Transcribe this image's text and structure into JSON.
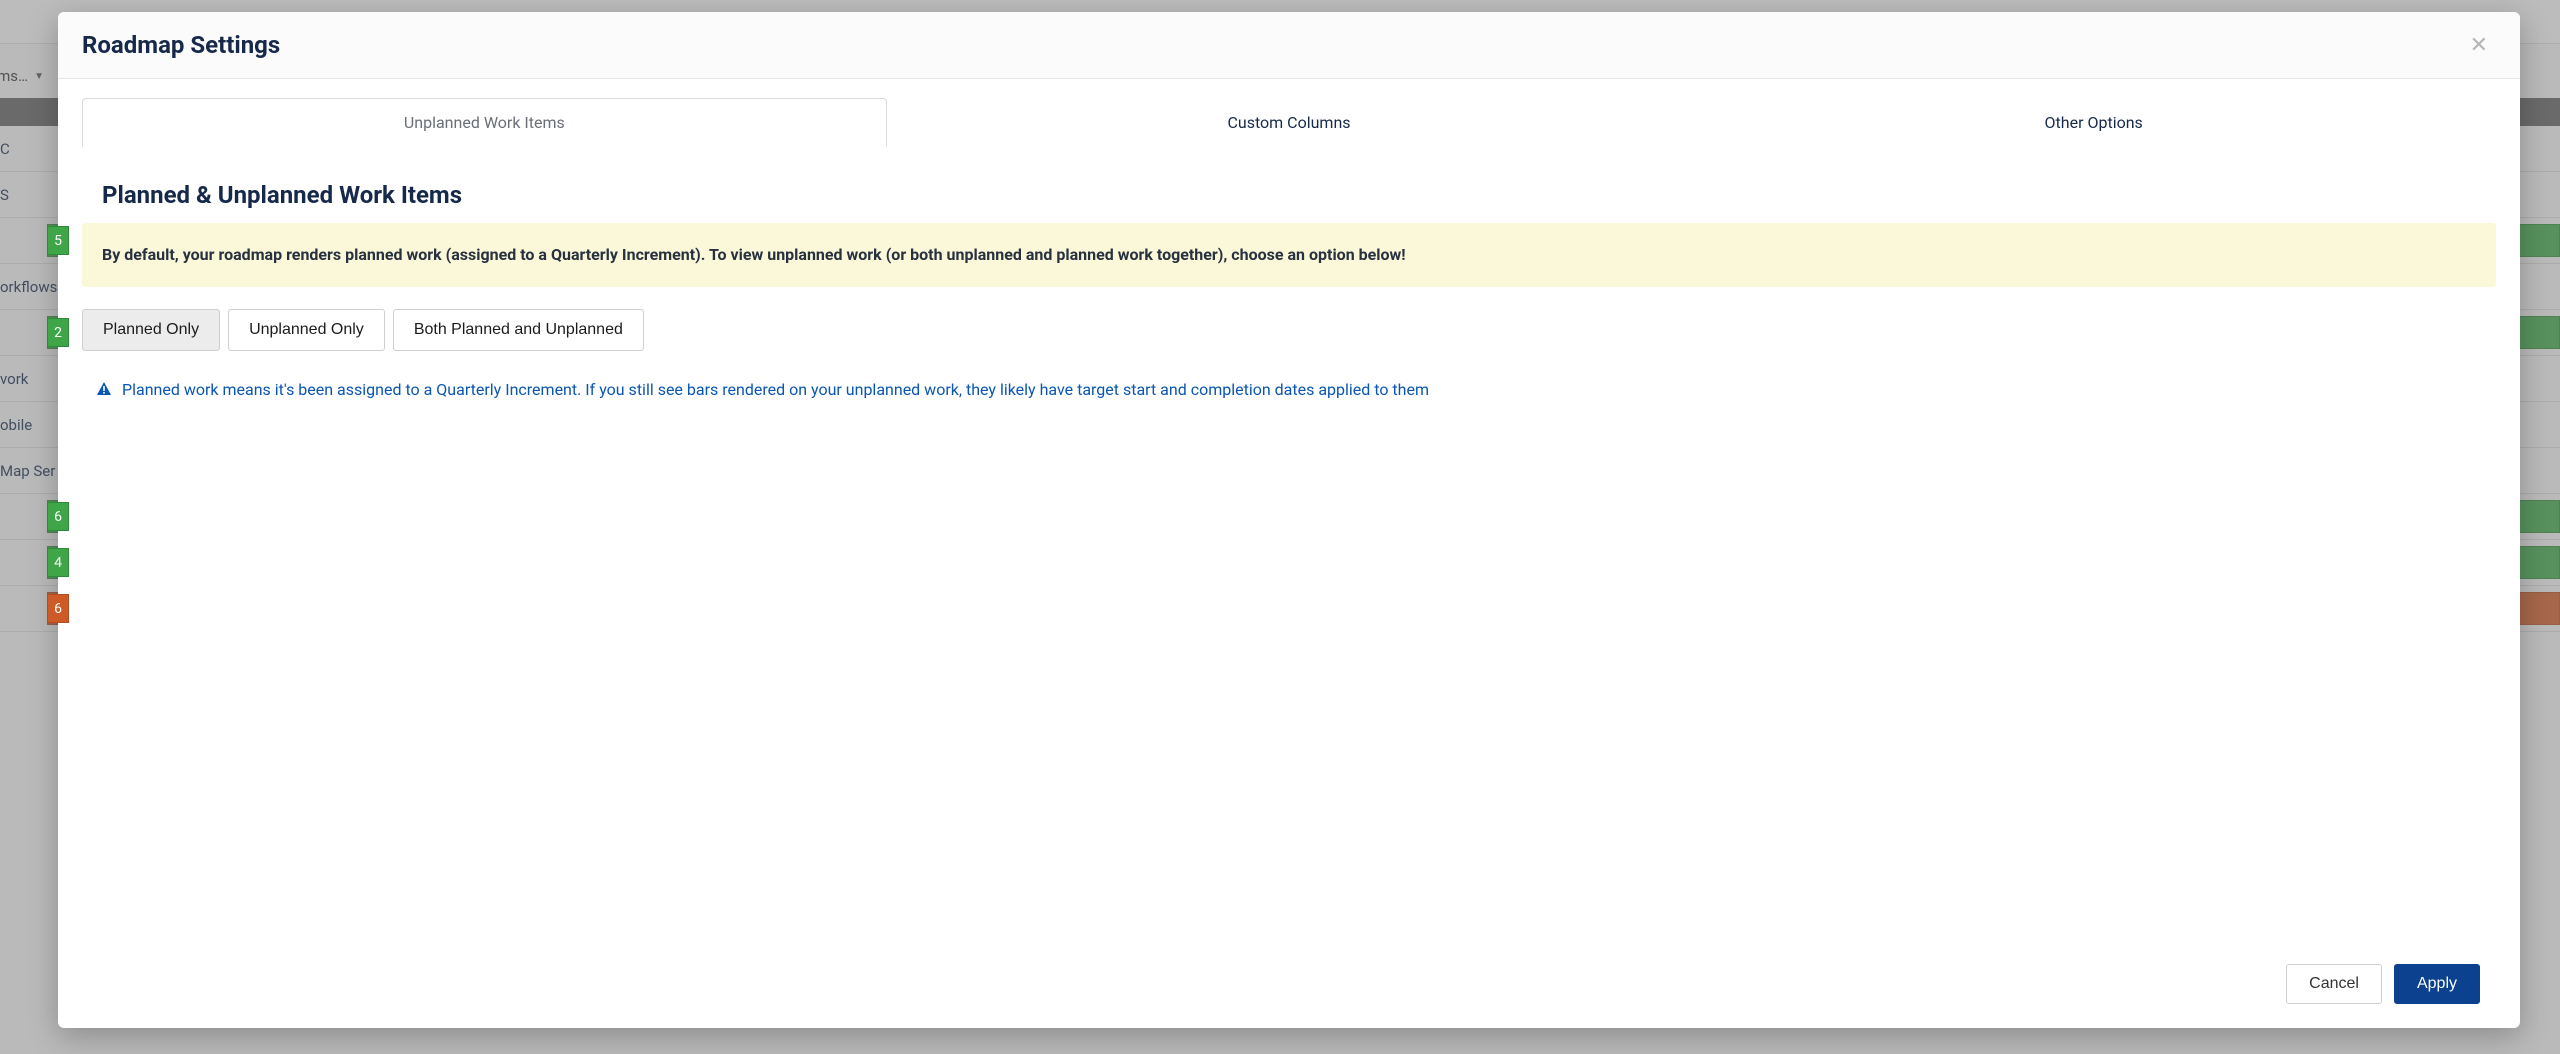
{
  "background": {
    "dropdown_text": "ms…",
    "rows": [
      {
        "type": "label",
        "text": "C"
      },
      {
        "type": "label",
        "text": "S"
      },
      {
        "type": "green_badge",
        "badge": "5"
      },
      {
        "type": "label",
        "text": "orkflows"
      },
      {
        "type": "green_badge",
        "badge": "2"
      },
      {
        "type": "label",
        "text": "vork"
      },
      {
        "type": "label",
        "text": "obile"
      },
      {
        "type": "label",
        "text": "Map Ser"
      },
      {
        "type": "green_badge",
        "badge": "6"
      },
      {
        "type": "green_badge",
        "badge": "4"
      },
      {
        "type": "orange_badge",
        "badge": "6"
      }
    ]
  },
  "modal": {
    "title": "Roadmap Settings",
    "tabs": [
      {
        "label": "Unplanned Work Items",
        "active": true
      },
      {
        "label": "Custom Columns",
        "active": false
      },
      {
        "label": "Other Options",
        "active": false
      }
    ],
    "section_heading": "Planned & Unplanned Work Items",
    "info_banner": "By default, your roadmap renders planned work (assigned to a Quarterly Increment). To view unplanned work (or both unplanned and planned work together), choose an option below!",
    "toggle_options": [
      {
        "label": "Planned Only",
        "selected": true
      },
      {
        "label": "Unplanned Only",
        "selected": false
      },
      {
        "label": "Both Planned and Unplanned",
        "selected": false
      }
    ],
    "note": "Planned work means it's been assigned to a Quarterly Increment. If you still see bars rendered on your unplanned work, they likely have target start and completion dates applied to them",
    "footer": {
      "cancel": "Cancel",
      "apply": "Apply"
    }
  }
}
